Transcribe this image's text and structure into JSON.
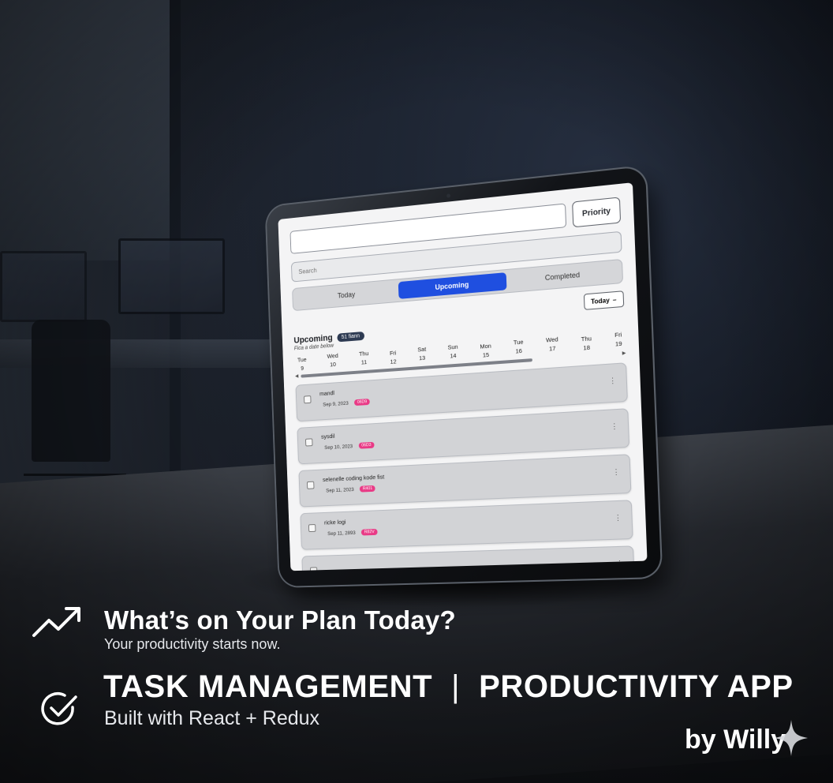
{
  "app": {
    "priority_label": "Priority",
    "search_placeholder": "Search",
    "tabs": [
      {
        "label": "Today",
        "active": false
      },
      {
        "label": "Upcoming",
        "active": true
      },
      {
        "label": "Completed",
        "active": false
      }
    ],
    "today_button": "Today",
    "today_chevron": "–",
    "section_title": "Upcoming",
    "section_badge": "51 fiann",
    "pick_hint": "Fica a date below",
    "dates": [
      {
        "day": "Tue",
        "num": "9"
      },
      {
        "day": "Wed",
        "num": "10"
      },
      {
        "day": "Thu",
        "num": "11"
      },
      {
        "day": "Fri",
        "num": "12"
      },
      {
        "day": "Sat",
        "num": "13"
      },
      {
        "day": "Sun",
        "num": "14"
      },
      {
        "day": "Mon",
        "num": "15"
      },
      {
        "day": "Tue",
        "num": "16"
      },
      {
        "day": "Wed",
        "num": "17"
      },
      {
        "day": "Thu",
        "num": "18"
      },
      {
        "day": "Fri",
        "num": "19"
      }
    ],
    "scroll_progress": 0.74,
    "tasks": [
      {
        "name": "mandl",
        "date": "Sep 9, 2023",
        "tag": "06D9"
      },
      {
        "name": "sysdil",
        "date": "Sep 10, 2023",
        "tag": "06D3"
      },
      {
        "name": "selenelle coding kode fist",
        "date": "Sep 11, 2023",
        "tag": "R401"
      },
      {
        "name": "ricke logi",
        "date": "Sep 11, 2893",
        "tag": "R82V"
      },
      {
        "name": "",
        "date": "",
        "tag": ""
      }
    ]
  },
  "overlay": {
    "headline": "What’s on Your Plan Today?",
    "subline": "Your productivity starts now.",
    "title_left": "TASK MANAGEMENT",
    "title_sep": "|",
    "title_right": "PRODUCTIVITY APP",
    "built_with": "Built with React + Redux",
    "byline": "by Willy"
  },
  "colors": {
    "accent_blue": "#1f4fe0",
    "tag_pink": "#e93a86",
    "badge_navy": "#2d3a52"
  },
  "icons": [
    "trend-up-icon",
    "check-circle-icon",
    "sparkle-icon",
    "more-vertical-icon"
  ]
}
